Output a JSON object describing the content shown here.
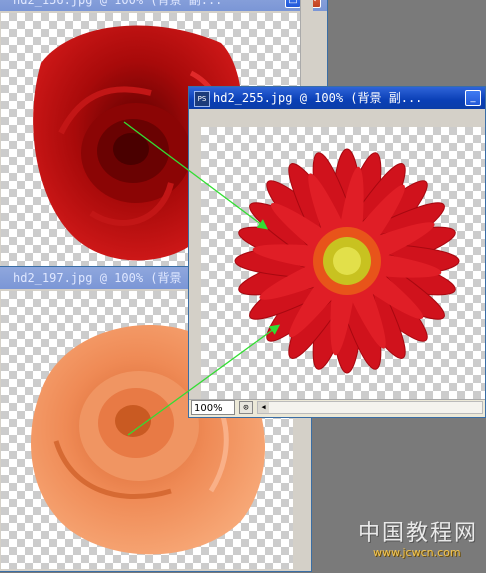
{
  "windows": {
    "top_left": {
      "title": "hd2_156.jpg @ 100% (背景 副..."
    },
    "bottom_left": {
      "title": "hd2_197.jpg @ 100% (背景"
    },
    "front": {
      "title": "hd2_255.jpg @ 100% (背景 副...",
      "zoom": "100%"
    }
  },
  "icons": {
    "app": "PS",
    "minimize": "minimize-icon",
    "maximize": "maximize-icon",
    "close": "close-icon",
    "navigator": "navigator-icon",
    "scroll_left": "arrow-left-icon"
  },
  "colors": {
    "title_active": "#0a3fb6",
    "title_inactive": "#7b96d6",
    "arrow": "#33dd33",
    "gray_workspace": "#7a7a7a"
  },
  "watermark": {
    "chinese": "中国教程网",
    "url": "www.jcwcn.com"
  }
}
